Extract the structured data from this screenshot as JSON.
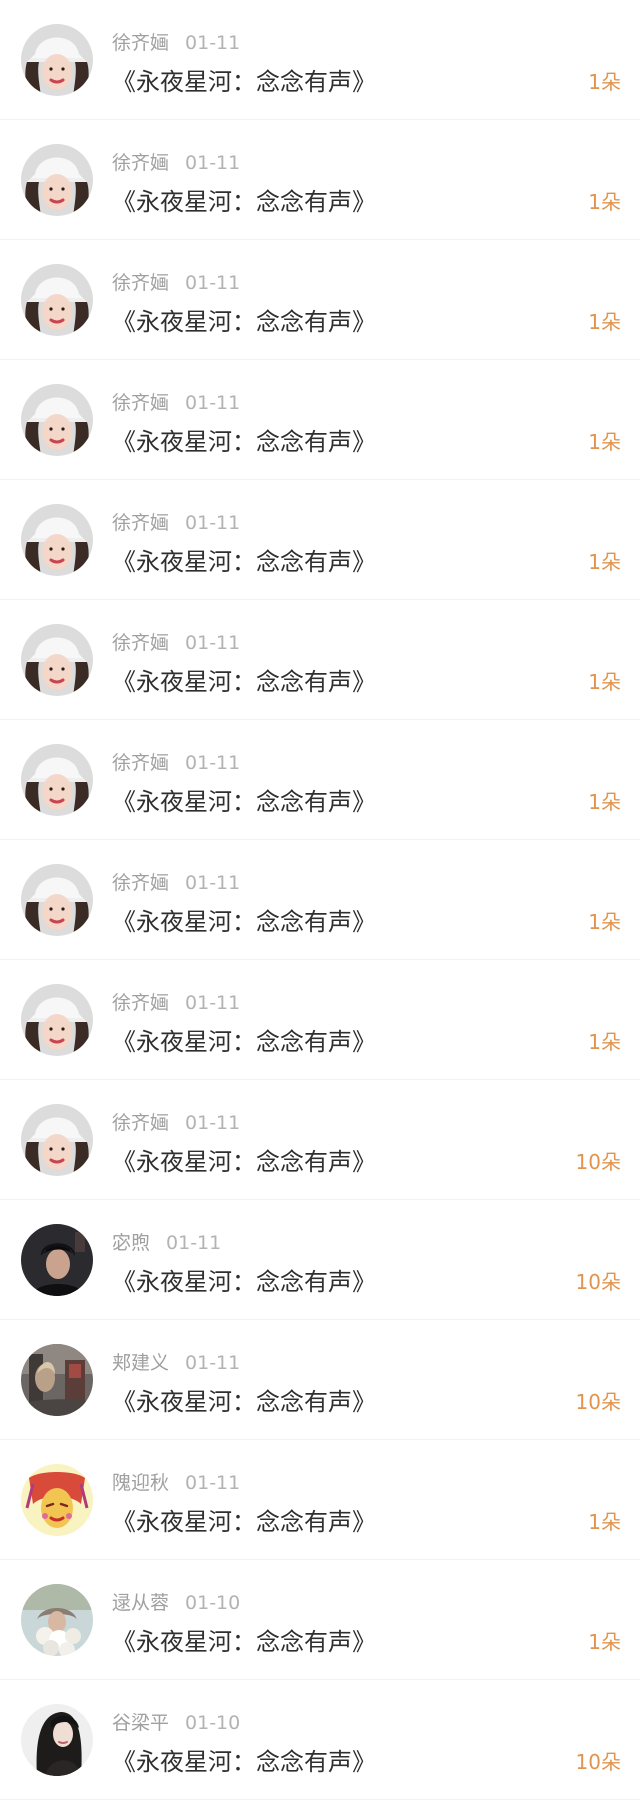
{
  "gift_list": [
    {
      "user": "徐齐婳",
      "date": "01-11",
      "title": "《永夜星河：念念有声》",
      "count": "1朵",
      "avatar": "avatar-woman-white-hat"
    },
    {
      "user": "徐齐婳",
      "date": "01-11",
      "title": "《永夜星河：念念有声》",
      "count": "1朵",
      "avatar": "avatar-woman-white-hat"
    },
    {
      "user": "徐齐婳",
      "date": "01-11",
      "title": "《永夜星河：念念有声》",
      "count": "1朵",
      "avatar": "avatar-woman-white-hat"
    },
    {
      "user": "徐齐婳",
      "date": "01-11",
      "title": "《永夜星河：念念有声》",
      "count": "1朵",
      "avatar": "avatar-woman-white-hat"
    },
    {
      "user": "徐齐婳",
      "date": "01-11",
      "title": "《永夜星河：念念有声》",
      "count": "1朵",
      "avatar": "avatar-woman-white-hat"
    },
    {
      "user": "徐齐婳",
      "date": "01-11",
      "title": "《永夜星河：念念有声》",
      "count": "1朵",
      "avatar": "avatar-woman-white-hat"
    },
    {
      "user": "徐齐婳",
      "date": "01-11",
      "title": "《永夜星河：念念有声》",
      "count": "1朵",
      "avatar": "avatar-woman-white-hat"
    },
    {
      "user": "徐齐婳",
      "date": "01-11",
      "title": "《永夜星河：念念有声》",
      "count": "1朵",
      "avatar": "avatar-woman-white-hat"
    },
    {
      "user": "徐齐婳",
      "date": "01-11",
      "title": "《永夜星河：念念有声》",
      "count": "1朵",
      "avatar": "avatar-woman-white-hat"
    },
    {
      "user": "徐齐婳",
      "date": "01-11",
      "title": "《永夜星河：念念有声》",
      "count": "10朵",
      "avatar": "avatar-woman-white-hat"
    },
    {
      "user": "宓煦",
      "date": "01-11",
      "title": "《永夜星河：念念有声》",
      "count": "10朵",
      "avatar": "avatar-man-dark"
    },
    {
      "user": "郏建义",
      "date": "01-11",
      "title": "《永夜星河：念念有声》",
      "count": "10朵",
      "avatar": "avatar-street-photo"
    },
    {
      "user": "隗迎秋",
      "date": "01-11",
      "title": "《永夜星河：念念有声》",
      "count": "1朵",
      "avatar": "avatar-colorful-drawing"
    },
    {
      "user": "逯从蓉",
      "date": "01-10",
      "title": "《永夜星河：念念有声》",
      "count": "1朵",
      "avatar": "avatar-flowers"
    },
    {
      "user": "谷梁平",
      "date": "01-10",
      "title": "《永夜星河：念念有声》",
      "count": "10朵",
      "avatar": "avatar-woman-long-hair"
    }
  ],
  "colors": {
    "username": "#a0a0a0",
    "date": "#b3b3b3",
    "title": "#2f2f2f",
    "count": "#e0944f",
    "divider": "#f2f2f2"
  }
}
